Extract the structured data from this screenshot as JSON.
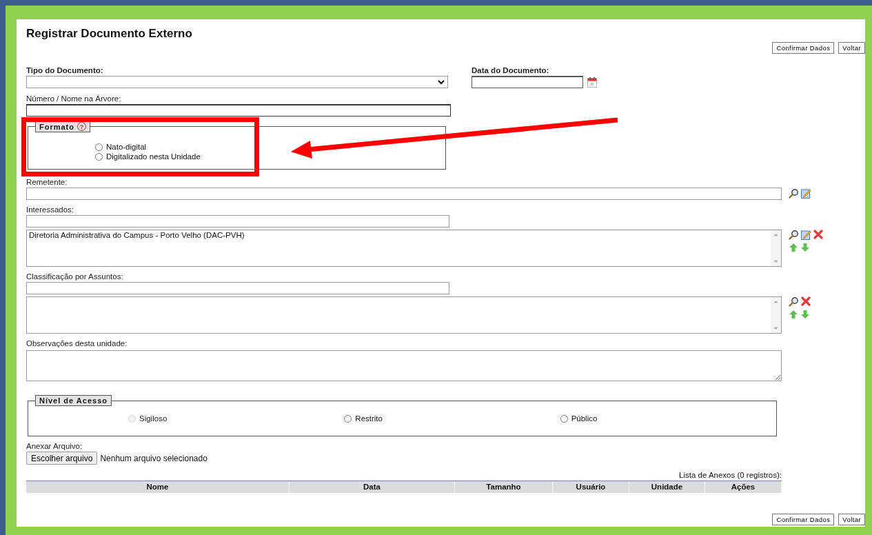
{
  "page": {
    "title": "Registrar Documento Externo"
  },
  "top_buttons": [
    {
      "label": "Confirmar Dados"
    },
    {
      "label": "Voltar"
    }
  ],
  "tipo_documento": {
    "label": "Tipo do Documento:"
  },
  "data_documento": {
    "label": "Data do Documento:"
  },
  "numero_nome": {
    "label": "Número / Nome na Árvore:"
  },
  "formato": {
    "legend": "Formato",
    "help": "?",
    "options": [
      {
        "label": "Nato-digital",
        "selected": false
      },
      {
        "label": "Digitalizado nesta Unidade",
        "selected": false
      }
    ]
  },
  "remetente": {
    "label": "Remetente:",
    "actions": [
      {
        "kind": "search"
      },
      {
        "kind": "edit"
      }
    ]
  },
  "interessados": {
    "label": "Interessados:",
    "items": [
      "Diretoria Administrativa do Campus - Porto Velho (DAC-PVH)"
    ],
    "actions": [
      {
        "kind": "search"
      },
      {
        "kind": "edit"
      },
      {
        "kind": "delete"
      },
      {
        "kind": "up"
      },
      {
        "kind": "down"
      }
    ]
  },
  "classificacao": {
    "label": "Classificação por Assuntos:",
    "actions": [
      {
        "kind": "search"
      },
      {
        "kind": "delete"
      },
      {
        "kind": "up"
      },
      {
        "kind": "down"
      }
    ]
  },
  "observacoes": {
    "label": "Observações desta unidade:"
  },
  "nivel_acesso": {
    "legend": "Nível de Acesso",
    "options": [
      {
        "label": "Sigiloso",
        "selected": false,
        "disabled": true
      },
      {
        "label": "Restrito",
        "selected": false,
        "disabled": false
      },
      {
        "label": "Público",
        "selected": false,
        "disabled": false
      }
    ]
  },
  "anexar": {
    "label": "Anexar Arquivo:",
    "button": "Escolher arquivo",
    "status": "Nenhum arquivo selecionado"
  },
  "anexos": {
    "caption": "Lista de Anexos (0 registros):",
    "columns": [
      "Nome",
      "Data",
      "Tamanho",
      "Usuário",
      "Unidade",
      "Ações"
    ]
  },
  "bottom_buttons": [
    {
      "label": "Confirmar Dados"
    },
    {
      "label": "Voltar"
    }
  ],
  "annotation": {
    "highlight_box": true,
    "arrow": true
  }
}
